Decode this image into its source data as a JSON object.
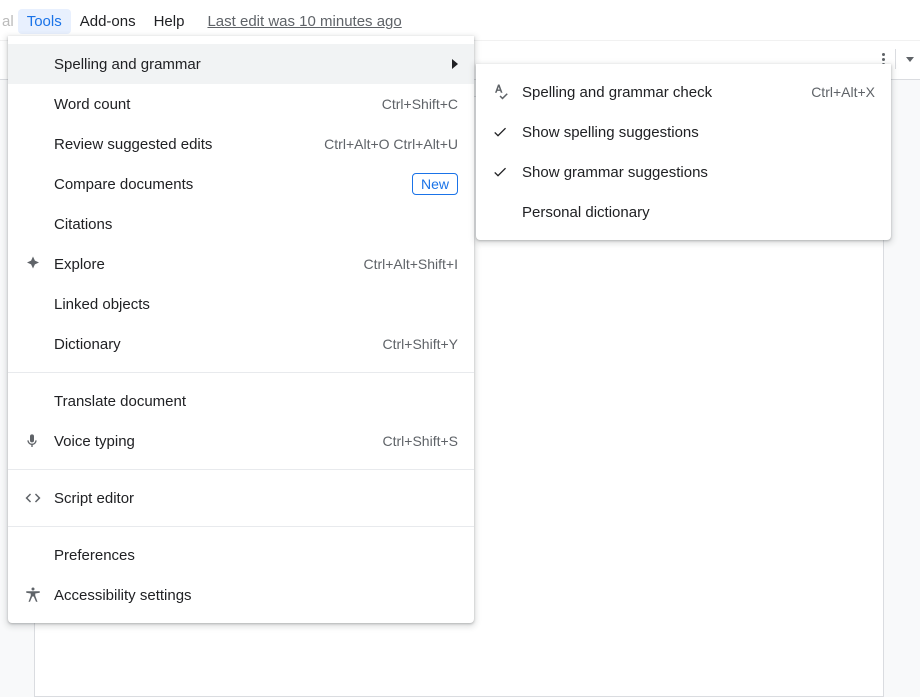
{
  "menubar": {
    "fragment": "al",
    "items": [
      "Tools",
      "Add-ons",
      "Help"
    ],
    "active_index": 0,
    "last_edit": "Last edit was 10 minutes ago"
  },
  "menu_main": {
    "items": {
      "spelling_grammar": {
        "label": "Spelling and grammar"
      },
      "word_count": {
        "label": "Word count",
        "shortcut": "Ctrl+Shift+C"
      },
      "review_edits": {
        "label": "Review suggested edits",
        "shortcut": "Ctrl+Alt+O Ctrl+Alt+U"
      },
      "compare_docs": {
        "label": "Compare documents",
        "badge": "New"
      },
      "citations": {
        "label": "Citations"
      },
      "explore": {
        "label": "Explore",
        "shortcut": "Ctrl+Alt+Shift+I"
      },
      "linked_objects": {
        "label": "Linked objects"
      },
      "dictionary": {
        "label": "Dictionary",
        "shortcut": "Ctrl+Shift+Y"
      },
      "translate": {
        "label": "Translate document"
      },
      "voice_typing": {
        "label": "Voice typing",
        "shortcut": "Ctrl+Shift+S"
      },
      "script_editor": {
        "label": "Script editor"
      },
      "preferences": {
        "label": "Preferences"
      },
      "accessibility": {
        "label": "Accessibility settings"
      }
    }
  },
  "menu_sub": {
    "items": {
      "check": {
        "label": "Spelling and grammar check",
        "shortcut": "Ctrl+Alt+X"
      },
      "show_spelling": {
        "label": "Show spelling suggestions"
      },
      "show_grammar": {
        "label": "Show grammar suggestions"
      },
      "personal_dict": {
        "label": "Personal dictionary"
      }
    }
  }
}
